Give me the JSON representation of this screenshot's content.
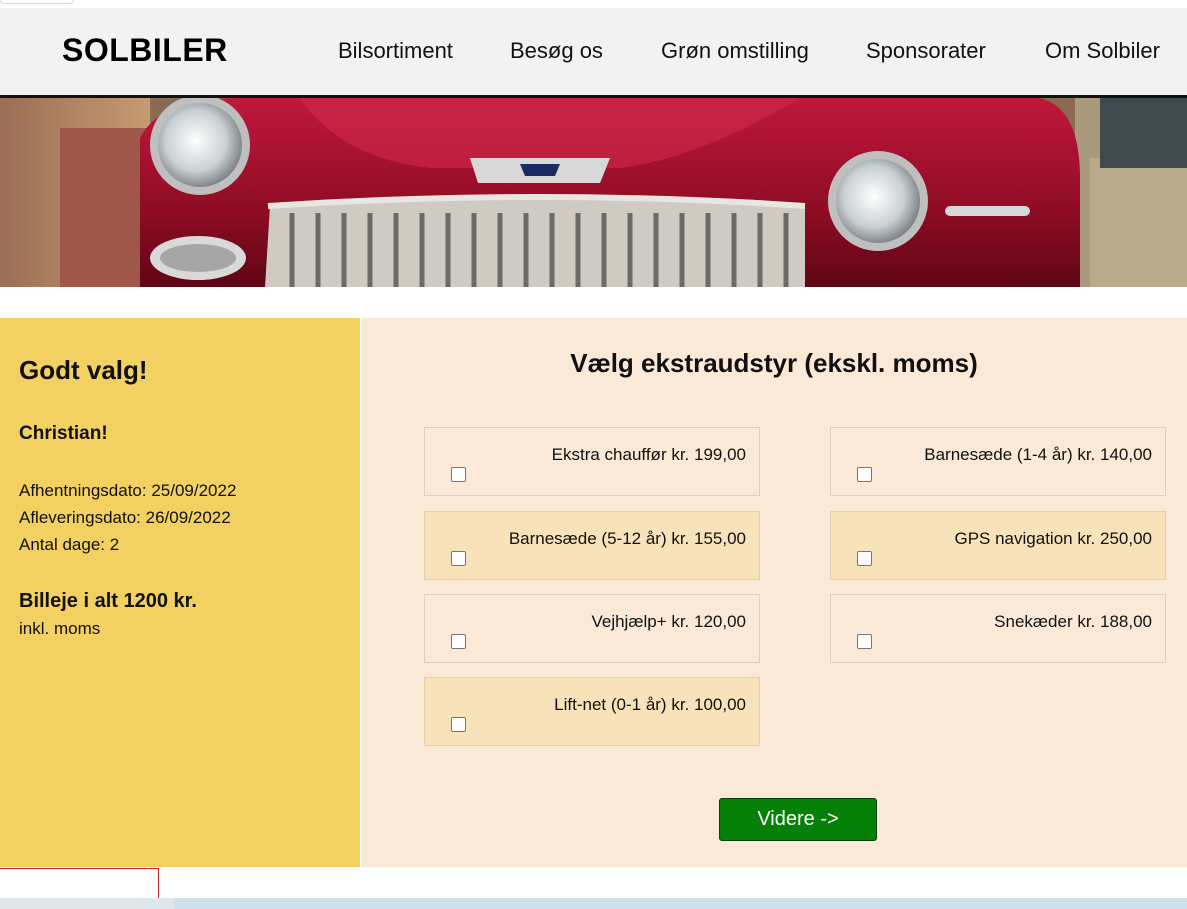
{
  "header": {
    "logo": "SOLBILER",
    "nav": [
      "Bilsortiment",
      "Besøg os",
      "Grøn omstilling",
      "Sponsorater",
      "Om Solbiler"
    ]
  },
  "summary": {
    "title": "Godt valg!",
    "name": "Christian!",
    "pickup": "Afhentningsdato: 25/09/2022",
    "dropoff": "Afleveringsdato: 26/09/2022",
    "days": "Antal dage: 2",
    "total": "Billeje i alt 1200 kr.",
    "vat_note": "inkl. moms"
  },
  "extras": {
    "title": "Vælg ekstraudstyr (ekskl. moms)",
    "options": [
      {
        "label": "Ekstra chauffør kr. 199,00",
        "checked": false
      },
      {
        "label": "Barnesæde (1-4 år) kr. 140,00",
        "checked": false
      },
      {
        "label": "Barnesæde (5-12 år) kr. 155,00",
        "checked": false
      },
      {
        "label": "GPS navigation kr. 250,00",
        "checked": false
      },
      {
        "label": "Vejhjælp+ kr. 120,00",
        "checked": false
      },
      {
        "label": "Snekæder kr. 188,00",
        "checked": false
      },
      {
        "label": "Lift-net (0-1 år) kr. 100,00",
        "checked": false
      }
    ],
    "continue_label": "Videre ->"
  },
  "colors": {
    "header_bg": "#f2f2f2",
    "summary_bg": "#f2d061",
    "extras_bg": "#f9e9d6",
    "option_alt_bg": "#f8e2b9",
    "button_bg": "#078007"
  }
}
